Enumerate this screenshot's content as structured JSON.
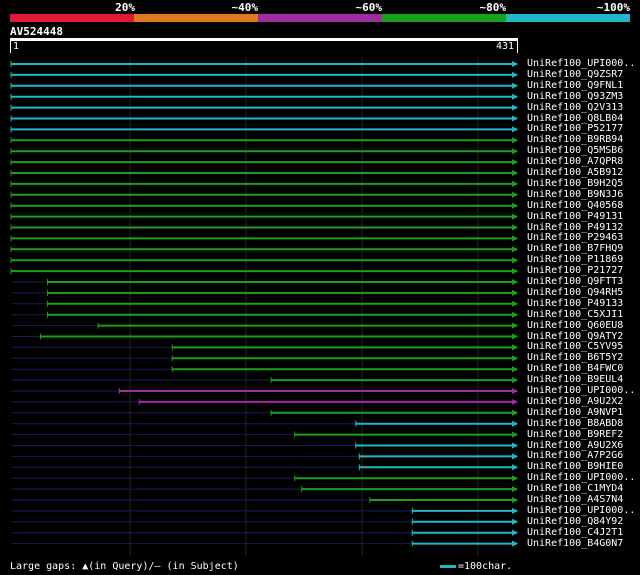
{
  "legend": {
    "labels": [
      "20%",
      "~40%",
      "~60%",
      "~80%",
      "~100%"
    ],
    "colors": [
      "#e01a33",
      "#e07820",
      "#a02aa0",
      "#1aa01a",
      "#20b8c8"
    ]
  },
  "query": {
    "name": "AV524448",
    "start": "1",
    "end": "431",
    "length": 431
  },
  "footer": {
    "gaps_text": "Large gaps: ▲(in Query)/– (in Subject)",
    "scale_text": "=100char."
  },
  "hits": [
    {
      "label": "UniRef100_UPI000..",
      "start": 1,
      "end": 431,
      "color": "#20b8c8",
      "dark_to": 0
    },
    {
      "label": "UniRef100_Q9ZSR7",
      "start": 1,
      "end": 431,
      "color": "#20b8c8",
      "dark_to": 0
    },
    {
      "label": "UniRef100_Q9FNL1",
      "start": 1,
      "end": 431,
      "color": "#20b8c8",
      "dark_to": 0
    },
    {
      "label": "UniRef100_Q93ZM3",
      "start": 1,
      "end": 431,
      "color": "#20b8c8",
      "dark_to": 0
    },
    {
      "label": "UniRef100_Q2V313",
      "start": 1,
      "end": 431,
      "color": "#20b8c8",
      "dark_to": 0
    },
    {
      "label": "UniRef100_Q8LB04",
      "start": 1,
      "end": 431,
      "color": "#20b8c8",
      "dark_to": 0
    },
    {
      "label": "UniRef100_P52177",
      "start": 1,
      "end": 431,
      "color": "#20b8c8",
      "dark_to": 0
    },
    {
      "label": "UniRef100_B9RB94",
      "start": 1,
      "end": 431,
      "color": "#1aa01a",
      "dark_to": 0
    },
    {
      "label": "UniRef100_Q5MSB6",
      "start": 1,
      "end": 431,
      "color": "#1aa01a",
      "dark_to": 0
    },
    {
      "label": "UniRef100_A7QPR8",
      "start": 1,
      "end": 431,
      "color": "#1aa01a",
      "dark_to": 0
    },
    {
      "label": "UniRef100_A5B912",
      "start": 1,
      "end": 431,
      "color": "#1aa01a",
      "dark_to": 0
    },
    {
      "label": "UniRef100_B9H2Q5",
      "start": 1,
      "end": 431,
      "color": "#1aa01a",
      "dark_to": 0
    },
    {
      "label": "UniRef100_B9N3J6",
      "start": 1,
      "end": 431,
      "color": "#1aa01a",
      "dark_to": 0
    },
    {
      "label": "UniRef100_Q40568",
      "start": 1,
      "end": 431,
      "color": "#1aa01a",
      "dark_to": 0
    },
    {
      "label": "UniRef100_P49131",
      "start": 1,
      "end": 431,
      "color": "#1aa01a",
      "dark_to": 0
    },
    {
      "label": "UniRef100_P49132",
      "start": 1,
      "end": 431,
      "color": "#1aa01a",
      "dark_to": 0
    },
    {
      "label": "UniRef100_P29463",
      "start": 1,
      "end": 431,
      "color": "#1aa01a",
      "dark_to": 0
    },
    {
      "label": "UniRef100_B7FHQ9",
      "start": 1,
      "end": 431,
      "color": "#1aa01a",
      "dark_to": 0
    },
    {
      "label": "UniRef100_P11869",
      "start": 1,
      "end": 431,
      "color": "#1aa01a",
      "dark_to": 0
    },
    {
      "label": "UniRef100_P21727",
      "start": 1,
      "end": 431,
      "color": "#1aa01a",
      "dark_to": 0
    },
    {
      "label": "UniRef100_Q9FTT3",
      "start": 32,
      "end": 431,
      "color": "#1aa01a",
      "dark_to": 32
    },
    {
      "label": "UniRef100_Q94RH5",
      "start": 32,
      "end": 431,
      "color": "#1aa01a",
      "dark_to": 32
    },
    {
      "label": "UniRef100_P49133",
      "start": 32,
      "end": 431,
      "color": "#1aa01a",
      "dark_to": 32
    },
    {
      "label": "UniRef100_C5XJI1",
      "start": 32,
      "end": 431,
      "color": "#1aa01a",
      "dark_to": 32
    },
    {
      "label": "UniRef100_Q60EU8",
      "start": 75,
      "end": 431,
      "color": "#1aa01a",
      "dark_to": 75
    },
    {
      "label": "UniRef100_Q9ATY2",
      "start": 26,
      "end": 431,
      "color": "#1aa01a",
      "dark_to": 26
    },
    {
      "label": "UniRef100_C5YV95",
      "start": 138,
      "end": 431,
      "color": "#1aa01a",
      "dark_to": 138
    },
    {
      "label": "UniRef100_B6T5Y2",
      "start": 138,
      "end": 431,
      "color": "#1aa01a",
      "dark_to": 138
    },
    {
      "label": "UniRef100_B4FWC0",
      "start": 138,
      "end": 431,
      "color": "#1aa01a",
      "dark_to": 138
    },
    {
      "label": "UniRef100_B9EUL4",
      "start": 222,
      "end": 431,
      "color": "#1aa01a",
      "dark_to": 222
    },
    {
      "label": "UniRef100_UPI000..",
      "start": 93,
      "end": 431,
      "color": "#a02aa0",
      "dark_to": 93
    },
    {
      "label": "UniRef100_A9U2X2",
      "start": 110,
      "end": 431,
      "color": "#a02aa0",
      "dark_to": 110
    },
    {
      "label": "UniRef100_A9NVP1",
      "start": 222,
      "end": 431,
      "color": "#1aa01a",
      "dark_to": 222
    },
    {
      "label": "UniRef100_B8ABD8",
      "start": 294,
      "end": 431,
      "color": "#20b8c8",
      "dark_to": 294
    },
    {
      "label": "UniRef100_B9REF2",
      "start": 242,
      "end": 431,
      "color": "#1aa01a",
      "dark_to": 242
    },
    {
      "label": "UniRef100_A9U2X6",
      "start": 294,
      "end": 431,
      "color": "#20b8c8",
      "dark_to": 294
    },
    {
      "label": "UniRef100_A7P2G6",
      "start": 297,
      "end": 431,
      "color": "#20b8c8",
      "dark_to": 297
    },
    {
      "label": "UniRef100_B9HIE0",
      "start": 297,
      "end": 431,
      "color": "#20b8c8",
      "dark_to": 297
    },
    {
      "label": "UniRef100_UPI000..",
      "start": 242,
      "end": 431,
      "color": "#1aa01a",
      "dark_to": 242
    },
    {
      "label": "UniRef100_C1MYD4",
      "start": 248,
      "end": 431,
      "color": "#1aa01a",
      "dark_to": 248
    },
    {
      "label": "UniRef100_A4S7N4",
      "start": 306,
      "end": 431,
      "color": "#1aa01a",
      "dark_to": 306
    },
    {
      "label": "UniRef100_UPI000..",
      "start": 342,
      "end": 431,
      "color": "#20b8c8",
      "dark_to": 342
    },
    {
      "label": "UniRef100_Q84Y92",
      "start": 342,
      "end": 431,
      "color": "#20b8c8",
      "dark_to": 342
    },
    {
      "label": "UniRef100_C4J2T1",
      "start": 342,
      "end": 431,
      "color": "#20b8c8",
      "dark_to": 342
    },
    {
      "label": "UniRef100_B4G0N7",
      "start": 342,
      "end": 431,
      "color": "#20b8c8",
      "dark_to": 342
    }
  ]
}
